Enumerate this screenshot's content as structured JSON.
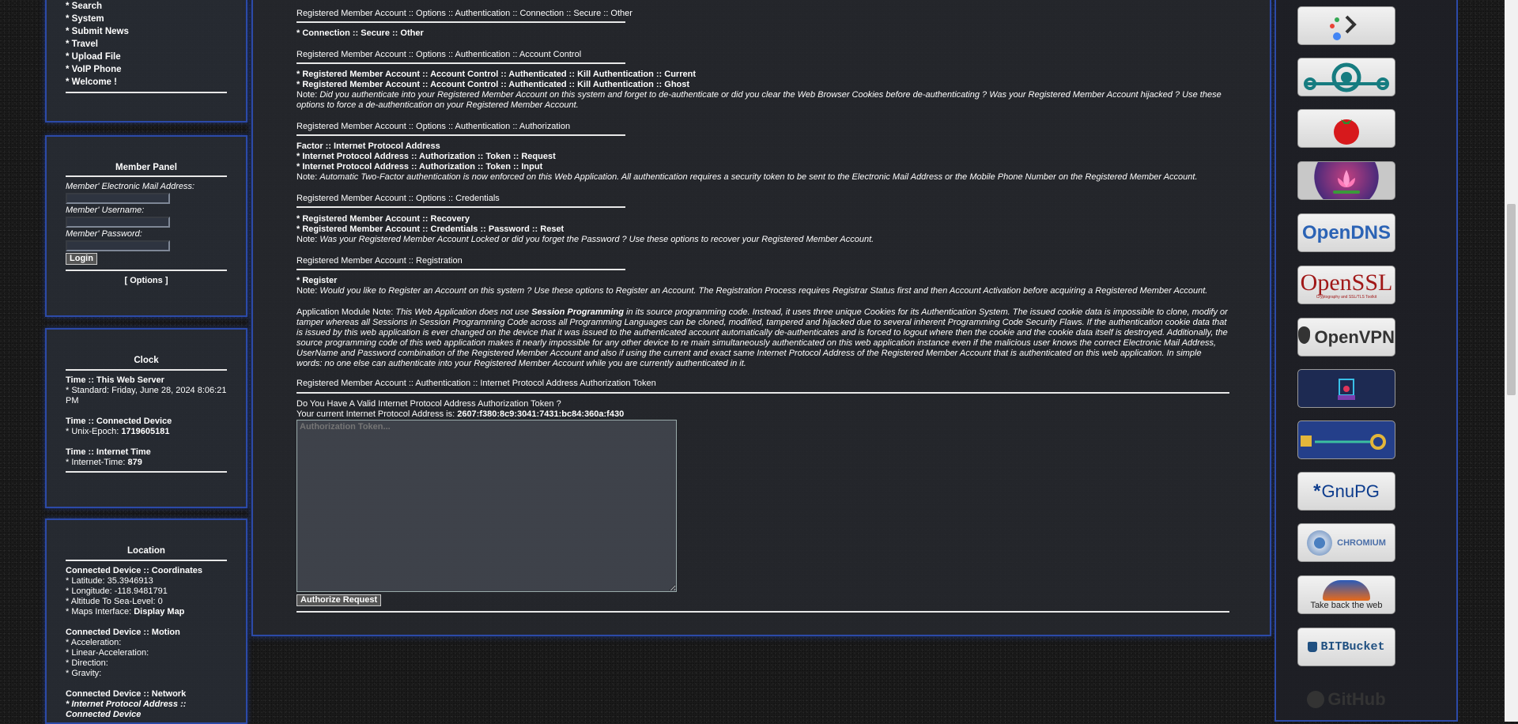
{
  "nav": {
    "items": [
      "* Search",
      "* System",
      "* Submit News",
      "* Travel",
      "* Upload File",
      "* VoIP Phone",
      "* Welcome !"
    ]
  },
  "member_panel": {
    "title": "Member Panel",
    "email_label": "Member' Electronic Mail Address:",
    "username_label": "Member' Username:",
    "password_label": "Member' Password:",
    "login_button": "Login",
    "options_link": "[ Options ]"
  },
  "clock": {
    "title": "Clock",
    "server_heading": "Time :: This Web Server",
    "server_value": "* Standard: Friday, June 28, 2024 8:06:21 PM",
    "device_heading": "Time :: Connected Device",
    "unix_label": "* Unix-Epoch: ",
    "unix_value": "1719605181",
    "internet_heading": "Time :: Internet Time",
    "internet_label": "* Internet-Time: ",
    "internet_value": "879"
  },
  "location": {
    "title": "Location",
    "coords_heading": "Connected Device :: Coordinates",
    "latitude": "* Latitude: 35.3946913",
    "longitude": "* Longitude: -118.9481791",
    "altitude": "* Altitude To Sea-Level: 0",
    "maps_label": "* Maps Interface: ",
    "maps_link": "Display Map",
    "motion_heading": "Connected Device :: Motion",
    "acceleration": "* Acceleration:",
    "linear_acceleration": "* Linear-Acceleration:",
    "direction": "* Direction:",
    "gravity": "* Gravity:",
    "network_heading": "Connected Device :: Network",
    "network_item": "* Internet Protocol Address :: Connected Device"
  },
  "main": {
    "s1_header": "Registered Member Account :: Options :: Authentication :: Connection :: Secure :: Other",
    "s1_item": "* Connection :: Secure :: Other",
    "s2_header": "Registered Member Account :: Options :: Authentication :: Account Control",
    "s2_item1": "* Registered Member Account :: Account Control :: Authenticated :: Kill Authentication :: Current",
    "s2_item2": "* Registered Member Account :: Account Control :: Authenticated :: Kill Authentication :: Ghost",
    "s2_note_label": "Note: ",
    "s2_note": "Did you authenticate into your Registered Member Account on this system and forget to de-authenticate or did you clear the Web Browser Cookies before de-authenticating ? Was your Registered Member Account hijacked ? Use these options to force a de-authentication on your Registered Member Account.",
    "s3_header": "Registered Member Account :: Options :: Authentication :: Authorization",
    "s3_item1": "Factor :: Internet Protocol Address",
    "s3_item2": "* Internet Protocol Address :: Authorization :: Token :: Request",
    "s3_item3": "* Internet Protocol Address :: Authorization :: Token :: Input",
    "s3_note_label": "Note: ",
    "s3_note": "Automatic Two-Factor authentication is now enforced on this Web Application. All authentication requires a security token to be sent to the Electronic Mail Address or the Mobile Phone Number on the Registered Member Account.",
    "s4_header": "Registered Member Account :: Options :: Credentials",
    "s4_item1": "* Registered Member Account :: Recovery",
    "s4_item2": "* Registered Member Account :: Credentials :: Password :: Reset",
    "s4_note_label": "Note: ",
    "s4_note": "Was your Registered Member Account Locked or did you forget the Password ? Use these options to recover your Registered Member Account.",
    "s5_header": "Registered Member Account :: Registration",
    "s5_item": "* Register",
    "s5_note_label": "Note: ",
    "s5_note": "Would you like to Register an Account on this system ? Use these options to Register an Account. The Registration Process requires Registrar Status first and then Account Activation before acquiring a Registered Member Account.",
    "app_note_label": "Application Module Note: ",
    "app_note_pre": "This Web Application does not use ",
    "app_note_bold": "Session Programming",
    "app_note_post": " in its source programming code. Instead, it uses three unique Cookies for its Authentication System. The issued cookie data is impossible to clone, modify or tamper whereas all Sessions in Session Programming Code across all Programming Languages can be cloned, modified, tampered and hijacked due to several inherent Programming Code Security Flaws. If the authentication cookie data that is issued by this web application is ever changed on the device that it was issued to the authenticated account automatically de-authenticates and is forced to logout where then the cookie and the cookie data itself is destroyed. Additionally, the source programming code of this web application makes it nearly impossible for any other device to re main simultaneously authenticated on this web application instance even if the malicious user knows the correct Electronic Mail Address, UserName and Password combination of the Registered Member Account and also if using the current and exact same Internet Protocol Address of the Registered Member Account that is authenticated on this web application. In simple words: no one else can authenticate into your Registered Member Account while you are currently authenticated in it.",
    "s6_header": "Registered Member Account :: Authentication :: Internet Protocol Address Authorization Token",
    "question": "Do You Have A Valid Internet Protocol Address Authorization Token ?",
    "ip_label": "Your current Internet Protocol Address is: ",
    "ip_value": "2607:f380:8c9:3041:7431:bc84:360a:f430",
    "token_placeholder": "Authorization Token...",
    "authorize_button": "Authorize Request"
  },
  "sidebar_tiles": [
    {
      "name": "google-dev-tile",
      "label": ""
    },
    {
      "name": "lineageos-tile",
      "label": ""
    },
    {
      "name": "tomato-tile",
      "label": ""
    },
    {
      "name": "lotus-tile",
      "label": ""
    },
    {
      "name": "opendns-tile",
      "label": "OpenDNS"
    },
    {
      "name": "openssl-tile",
      "label": "OpenSSL",
      "sub": "Cryptography and SSL/TLS Toolkit"
    },
    {
      "name": "openvpn-tile",
      "label": "OpenVPN"
    },
    {
      "name": "security-tile",
      "label": ""
    },
    {
      "name": "key-tile",
      "label": ""
    },
    {
      "name": "gnupg-tile",
      "label": "GnuPG"
    },
    {
      "name": "chromium-tile",
      "label": "CHROMIUM"
    },
    {
      "name": "firefox-tile",
      "label": "Take back the web"
    },
    {
      "name": "bitbucket-tile",
      "label": "BITBucket"
    },
    {
      "name": "github-tile",
      "label": "GitHub"
    }
  ]
}
